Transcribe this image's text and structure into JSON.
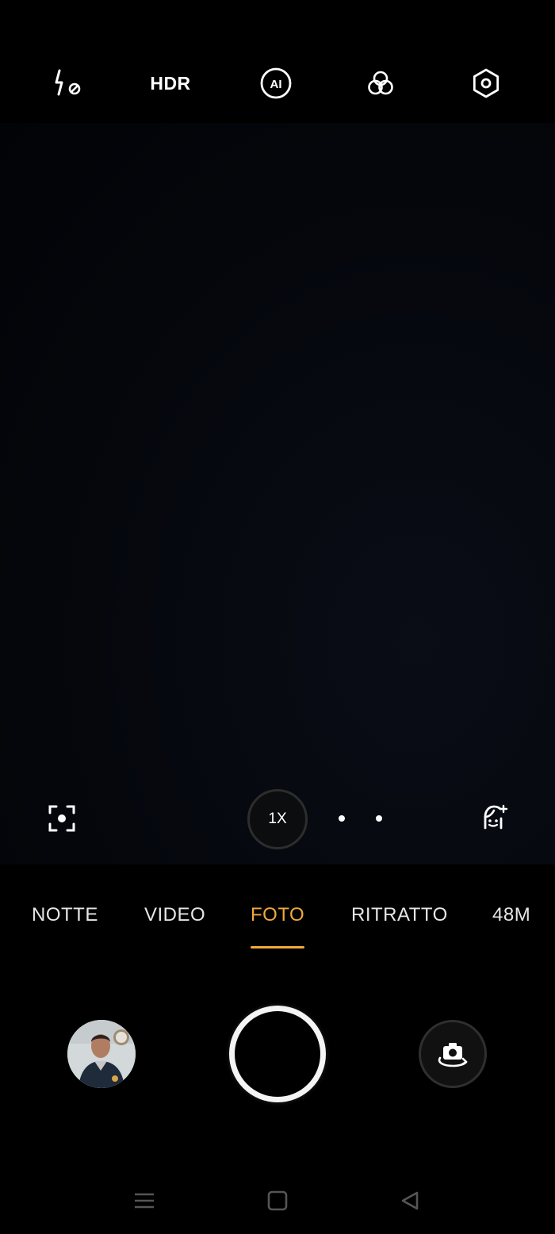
{
  "top_bar": {
    "icons": [
      "flash-off-icon",
      "hdr-icon",
      "ai-scene-icon",
      "filter-icon",
      "settings-icon"
    ],
    "hdr_label": "HDR",
    "ai_label": "AI"
  },
  "viewfinder": {
    "zoom_label": "1X",
    "left_icon": "focus-scan-icon",
    "right_icon": "beauty-face-icon"
  },
  "modes": {
    "items": [
      "NOTTE",
      "VIDEO",
      "FOTO",
      "RITRATTO",
      "48M"
    ],
    "active": "FOTO"
  },
  "controls": {
    "gallery_icon": "gallery-thumbnail",
    "shutter_icon": "shutter-button",
    "flip_icon": "switch-camera-icon"
  },
  "navbar": {
    "icons": [
      "menu-icon",
      "home-icon",
      "back-icon"
    ]
  },
  "colors": {
    "accent": "#f2a93b",
    "background": "#000000",
    "text": "#ffffff"
  }
}
